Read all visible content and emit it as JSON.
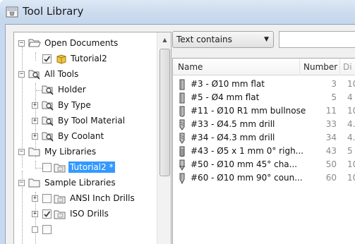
{
  "window": {
    "title": "Tool Library"
  },
  "tree": {
    "nodes": [
      {
        "label": "Open Documents",
        "expander": "−"
      },
      {
        "label": "Tutorial2",
        "checked": true
      },
      {
        "label": "All Tools",
        "expander": "−"
      },
      {
        "label": "Holder"
      },
      {
        "label": "By Type",
        "expander": "+"
      },
      {
        "label": "By Tool Material",
        "expander": "+"
      },
      {
        "label": "By Coolant",
        "expander": "+"
      },
      {
        "label": "My Libraries",
        "expander": "−"
      },
      {
        "label": "Tutorial2 *",
        "selected": true
      },
      {
        "label": "Sample Libraries",
        "expander": "−"
      },
      {
        "label": "ANSI Inch Drills",
        "expander": "+"
      },
      {
        "label": "ISO Drills",
        "expander": "+",
        "checked": true
      }
    ]
  },
  "filter": {
    "selected": "Text contains",
    "search_value": ""
  },
  "list": {
    "columns": {
      "name": "Number",
      "col1": "Name",
      "col2": "Number",
      "col3": "Di"
    },
    "rows": [
      {
        "name": "#3 - Ø10 mm flat",
        "number": "3",
        "dia": "10",
        "icon": "flat-endmill-icon"
      },
      {
        "name": "#5 - Ø4 mm flat",
        "number": "5",
        "dia": "4",
        "icon": "flat-endmill-icon"
      },
      {
        "name": "#11 - Ø10 R1 mm bullnose",
        "number": "11",
        "dia": "10",
        "icon": "bullnose-endmill-icon"
      },
      {
        "name": "#33 - Ø4.5 mm drill",
        "number": "33",
        "dia": "4.5",
        "icon": "drill-icon"
      },
      {
        "name": "#34 - Ø4.3 mm drill",
        "number": "34",
        "dia": "4.3",
        "icon": "drill-icon"
      },
      {
        "name": "#43 - Ø5 x 1 mm 0° righ...",
        "number": "43",
        "dia": "5",
        "icon": "tap-icon"
      },
      {
        "name": "#50 - Ø10 mm 45° cha...",
        "number": "50",
        "dia": "10",
        "icon": "chamfer-icon"
      },
      {
        "name": "#60 - Ø10 mm 90° coun...",
        "number": "60",
        "dia": "10",
        "icon": "countersink-icon"
      }
    ]
  }
}
